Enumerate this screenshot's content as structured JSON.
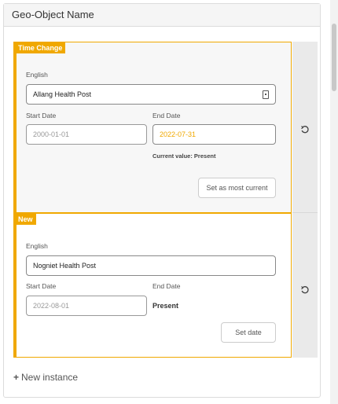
{
  "header": {
    "title": "Geo-Object Name"
  },
  "time_change": {
    "badge": "Time Change",
    "language_label": "English",
    "name_value": "Allang Health Post",
    "start_label": "Start Date",
    "start_value": "2000-01-01",
    "end_label": "End Date",
    "end_value": "2022-07-31",
    "current_value_hint": "Current value: Present",
    "action_label": "Set as most current"
  },
  "new_entry": {
    "badge": "New",
    "language_label": "English",
    "name_value": "Nogniet Health Post",
    "start_label": "Start Date",
    "start_value": "2022-08-01",
    "end_label": "End Date",
    "end_value": "Present",
    "action_label": "Set date"
  },
  "footer": {
    "new_instance_label": "New instance"
  },
  "icons": {
    "undo": "undo-icon",
    "plus": "plus-icon",
    "lock": "lock-icon"
  },
  "colors": {
    "accent": "#f0a800",
    "panel_bg": "#f7f7f7",
    "side_bg": "#eaeaea"
  }
}
